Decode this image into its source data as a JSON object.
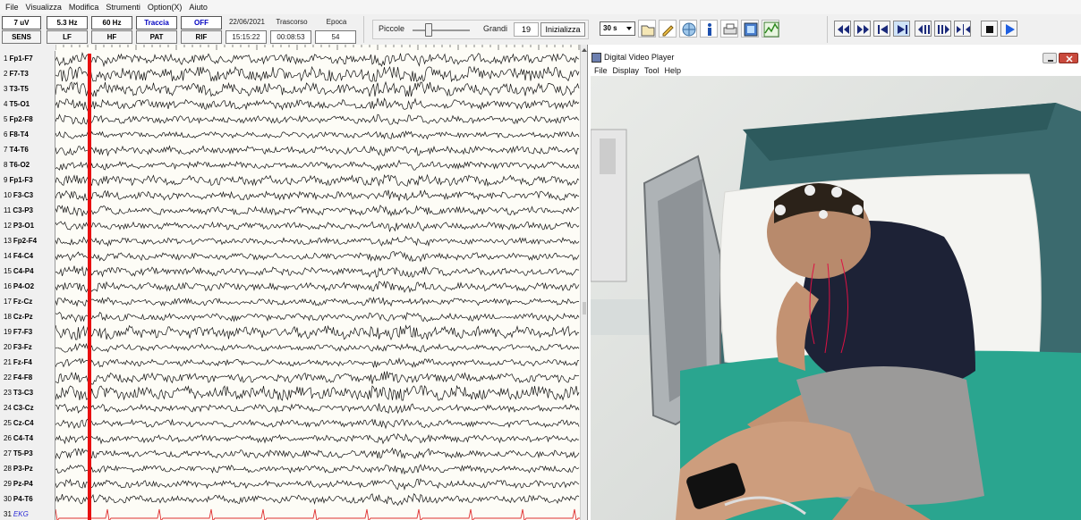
{
  "menu": [
    "File",
    "Visualizza",
    "Modifica",
    "Strumenti",
    "Option(X)",
    "Aiuto"
  ],
  "params": {
    "sens_value": "7 uV",
    "sens_label": "SENS",
    "lf_value": "5.3 Hz",
    "lf_label": "LF",
    "hf_value": "60 Hz",
    "hf_label": "HF",
    "pat_value": "Traccia",
    "pat_label": "PAT",
    "rif_value": "OFF",
    "rif_label": "RIF",
    "date": "22/06/2021",
    "time": "15:15:22",
    "elapsed_label": "Trascorso",
    "elapsed": "00:08:53",
    "epoch_label": "Epoca",
    "epoch": "54"
  },
  "zoom": {
    "small_label": "Piccole",
    "large_label": "Grandi",
    "value": "19",
    "init_label": "Inizializza"
  },
  "timebase": "30 s",
  "channels": [
    "Fp1-F7",
    "F7-T3",
    "T3-T5",
    "T5-O1",
    "Fp2-F8",
    "F8-T4",
    "T4-T6",
    "T6-O2",
    "Fp1-F3",
    "F3-C3",
    "C3-P3",
    "P3-O1",
    "Fp2-F4",
    "F4-C4",
    "C4-P4",
    "P4-O2",
    "Fz-Cz",
    "Cz-Pz",
    "F7-F3",
    "F3-Fz",
    "Fz-F4",
    "F4-F8",
    "T3-C3",
    "C3-Cz",
    "Cz-C4",
    "C4-T4",
    "T5-P3",
    "P3-Pz",
    "Pz-P4",
    "P4-T6",
    "EKG"
  ],
  "video_player": {
    "title": "Digital Video Player",
    "menu": [
      "File",
      "Display",
      "Tool",
      "Help"
    ]
  },
  "colors": {
    "marker": "#e81010",
    "ekg": "#e03030",
    "trace": "#111111"
  }
}
